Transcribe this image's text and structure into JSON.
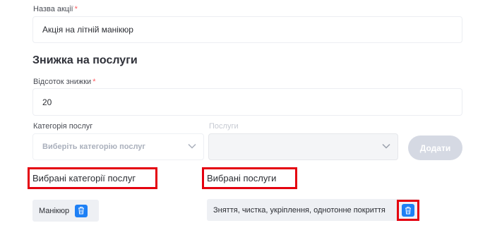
{
  "promo_name": {
    "label": "Назва акції",
    "required_mark": "*",
    "value": "Акція на літній манікюр"
  },
  "discount_section": {
    "title": "Знижка на послуги",
    "percent_label": "Відсоток знижки",
    "required_mark": "*",
    "percent_value": "20"
  },
  "category_select": {
    "label": "Категорія послуг",
    "placeholder": "Виберіть категорію послуг",
    "chevron_icon": "chevron-down-icon"
  },
  "services_select": {
    "label": "Послуги",
    "value": "",
    "disabled": true,
    "chevron_icon": "chevron-down-icon"
  },
  "add_button": {
    "label": "Додати"
  },
  "selected_categories": {
    "title": "Вибрані категорії послуг",
    "items": [
      {
        "label": "Манікюр",
        "delete_icon": "trash-icon"
      }
    ]
  },
  "selected_services": {
    "title": "Вибрані послуги",
    "items": [
      {
        "label": "Зняття, чистка, укріплення, однотонне покриття",
        "delete_icon": "trash-icon"
      }
    ]
  },
  "colors": {
    "accent": "#1e80f5",
    "required": "#ff5a5f",
    "highlight": "#e4000f",
    "button_disabled": "#d5d9e3",
    "chip_bg": "#eef0f4"
  }
}
